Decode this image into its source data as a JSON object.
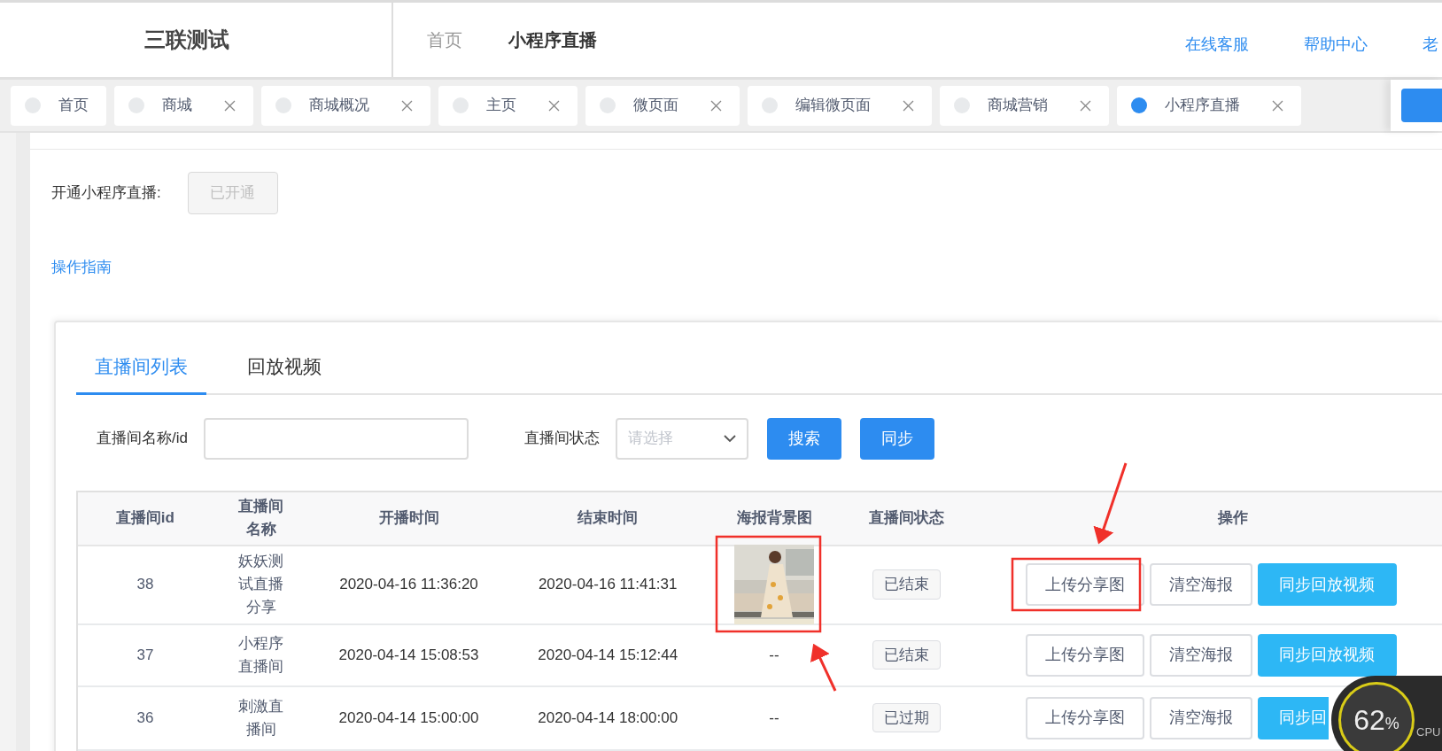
{
  "header": {
    "logo": "三联测试",
    "nav": [
      {
        "label": "首页",
        "selected": false
      },
      {
        "label": "小程序直播",
        "selected": true
      }
    ],
    "links": [
      "在线客服",
      "帮助中心",
      "老"
    ]
  },
  "page_tabs": [
    {
      "label": "首页",
      "selected": false,
      "closable": false
    },
    {
      "label": "商城",
      "selected": false,
      "closable": true
    },
    {
      "label": "商城概况",
      "selected": false,
      "closable": true
    },
    {
      "label": "主页",
      "selected": false,
      "closable": true
    },
    {
      "label": "微页面",
      "selected": false,
      "closable": true
    },
    {
      "label": "编辑微页面",
      "selected": false,
      "closable": true
    },
    {
      "label": "商城营销",
      "selected": false,
      "closable": true
    },
    {
      "label": "小程序直播",
      "selected": true,
      "closable": true
    }
  ],
  "activation": {
    "label": "开通小程序直播:",
    "button": "已开通",
    "disabled": true
  },
  "guide_link": "操作指南",
  "content_tabs": [
    {
      "label": "直播间列表",
      "selected": true
    },
    {
      "label": "回放视频",
      "selected": false
    }
  ],
  "filters": {
    "name_label": "直播间名称/id",
    "status_label": "直播间状态",
    "status_placeholder": "请选择",
    "buttons": [
      "搜索",
      "同步"
    ]
  },
  "table": {
    "columns": [
      "直播间id",
      "直播间名称",
      "开播时间",
      "结束时间",
      "海报背景图",
      "直播间状态",
      "操作"
    ],
    "rows": [
      {
        "id": "38",
        "name": "妖妖测试直播分享",
        "start": "2020-04-16 11:36:20",
        "end": "2020-04-16 11:41:31",
        "status": "已结束",
        "actions": [
          "上传分享图",
          "清空海报",
          "同步回放视频"
        ]
      },
      {
        "id": "37",
        "name": "小程序直播间",
        "start": "2020-04-14 15:08:53",
        "end": "2020-04-14 15:12:44",
        "poster": {
          "kind": "text",
          "text": "--"
        },
        "status": "已结束",
        "actions": [
          "上传分享图",
          "清空海报",
          "同步回放视频"
        ]
      },
      {
        "id": "36",
        "name": "刺激直播间",
        "start": "2020-04-14 15:00:00",
        "end": "2020-04-14 18:00:00",
        "poster": {
          "kind": "text",
          "text": "--"
        },
        "status": "已过期",
        "actions": [
          "上传分享图",
          "清空海报",
          "同步回"
        ]
      }
    ]
  },
  "cpu_widget": {
    "value": "62",
    "unit": "%",
    "label": "CPU"
  }
}
